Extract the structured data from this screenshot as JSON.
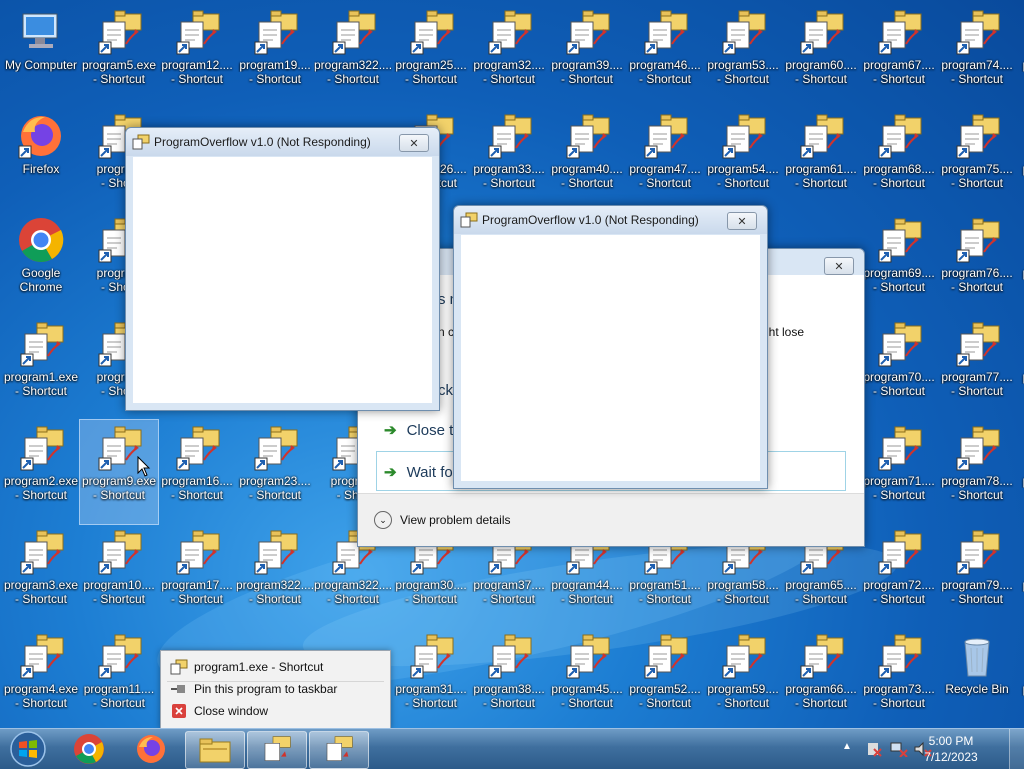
{
  "desktop": {
    "icons": [
      {
        "label1": "My Computer",
        "label2": "",
        "type": "computer",
        "col": 0,
        "row": 0
      },
      {
        "label1": "Firefox",
        "label2": "",
        "type": "firefox",
        "col": 0,
        "row": 1
      },
      {
        "label1": "Google",
        "label2": "Chrome",
        "type": "chrome",
        "col": 0,
        "row": 2
      },
      {
        "label1": "program1.exe",
        "label2": "- Shortcut",
        "type": "shortcut",
        "col": 0,
        "row": 3
      },
      {
        "label1": "program2.exe",
        "label2": "- Shortcut",
        "type": "shortcut",
        "col": 0,
        "row": 4
      },
      {
        "label1": "program3.exe",
        "label2": "- Shortcut",
        "type": "shortcut",
        "col": 0,
        "row": 5
      },
      {
        "label1": "program4.exe",
        "label2": "- Shortcut",
        "type": "shortcut",
        "col": 0,
        "row": 6
      },
      {
        "label1": "program5.exe",
        "label2": "- Shortcut",
        "type": "shortcut",
        "col": 1,
        "row": 0
      },
      {
        "label1": "program",
        "label2": "- Short",
        "type": "shortcut",
        "col": 1,
        "row": 1
      },
      {
        "label1": "program",
        "label2": "- Short",
        "type": "shortcut",
        "col": 1,
        "row": 2
      },
      {
        "label1": "program",
        "label2": "- Short",
        "type": "shortcut",
        "col": 1,
        "row": 3
      },
      {
        "label1": "program9.exe",
        "label2": "- Shortcut",
        "type": "shortcut",
        "col": 1,
        "row": 4,
        "selected": true
      },
      {
        "label1": "program10....",
        "label2": "- Shortcut",
        "type": "shortcut",
        "col": 1,
        "row": 5
      },
      {
        "label1": "program11....",
        "label2": "- Shortcut",
        "type": "shortcut",
        "col": 1,
        "row": 6
      },
      {
        "label1": "program12....",
        "label2": "- Shortcut",
        "type": "shortcut",
        "col": 2,
        "row": 0
      },
      {
        "label1": "program16....",
        "label2": "- Shortcut",
        "type": "shortcut",
        "col": 2,
        "row": 4
      },
      {
        "label1": "program17....",
        "label2": "- Shortcut",
        "type": "shortcut",
        "col": 2,
        "row": 5
      },
      {
        "label1": "program19....",
        "label2": "- Shortcut",
        "type": "shortcut",
        "col": 3,
        "row": 0
      },
      {
        "label1": "program23....",
        "label2": "- Shortcut",
        "type": "shortcut",
        "col": 3,
        "row": 4
      },
      {
        "label1": "program322....",
        "label2": "- Shortcut",
        "type": "shortcut",
        "col": 3,
        "row": 5
      },
      {
        "label1": "program322....",
        "label2": "- Shortcut",
        "type": "shortcut",
        "col": 4,
        "row": 0
      },
      {
        "label1": "program",
        "label2": "- Shor",
        "type": "shortcut",
        "col": 4,
        "row": 4
      },
      {
        "label1": "program322....",
        "label2": "- Shortcut",
        "type": "shortcut",
        "col": 4,
        "row": 5
      },
      {
        "label1": "program25....",
        "label2": "- Shortcut",
        "type": "shortcut",
        "col": 5,
        "row": 0
      },
      {
        "label1": "program26....",
        "label2": "- Shortcut",
        "type": "shortcut",
        "col": 5,
        "row": 1
      },
      {
        "label1": "program30....",
        "label2": "- Shortcut",
        "type": "shortcut",
        "col": 5,
        "row": 5
      },
      {
        "label1": "program31....",
        "label2": "- Shortcut",
        "type": "shortcut",
        "col": 5,
        "row": 6
      },
      {
        "label1": "program32....",
        "label2": "- Shortcut",
        "type": "shortcut",
        "col": 6,
        "row": 0
      },
      {
        "label1": "program33....",
        "label2": "- Shortcut",
        "type": "shortcut",
        "col": 6,
        "row": 1
      },
      {
        "label1": "program37....",
        "label2": "- Shortcut",
        "type": "shortcut",
        "col": 6,
        "row": 5
      },
      {
        "label1": "program38....",
        "label2": "- Shortcut",
        "type": "shortcut",
        "col": 6,
        "row": 6
      },
      {
        "label1": "program39....",
        "label2": "- Shortcut",
        "type": "shortcut",
        "col": 7,
        "row": 0
      },
      {
        "label1": "program40....",
        "label2": "- Shortcut",
        "type": "shortcut",
        "col": 7,
        "row": 1
      },
      {
        "label1": "program44....",
        "label2": "- Shortcut",
        "type": "shortcut",
        "col": 7,
        "row": 5
      },
      {
        "label1": "program45....",
        "label2": "- Shortcut",
        "type": "shortcut",
        "col": 7,
        "row": 6
      },
      {
        "label1": "program46....",
        "label2": "- Shortcut",
        "type": "shortcut",
        "col": 8,
        "row": 0
      },
      {
        "label1": "program47....",
        "label2": "- Shortcut",
        "type": "shortcut",
        "col": 8,
        "row": 1
      },
      {
        "label1": "program51....",
        "label2": "- Shortcut",
        "type": "shortcut",
        "col": 8,
        "row": 5
      },
      {
        "label1": "program52....",
        "label2": "- Shortcut",
        "type": "shortcut",
        "col": 8,
        "row": 6
      },
      {
        "label1": "program53....",
        "label2": "- Shortcut",
        "type": "shortcut",
        "col": 9,
        "row": 0
      },
      {
        "label1": "program54....",
        "label2": "- Shortcut",
        "type": "shortcut",
        "col": 9,
        "row": 1
      },
      {
        "label1": "program58....",
        "label2": "- Shortcut",
        "type": "shortcut",
        "col": 9,
        "row": 5
      },
      {
        "label1": "program59....",
        "label2": "- Shortcut",
        "type": "shortcut",
        "col": 9,
        "row": 6
      },
      {
        "label1": "program60....",
        "label2": "- Shortcut",
        "type": "shortcut",
        "col": 10,
        "row": 0
      },
      {
        "label1": "program61....",
        "label2": "- Shortcut",
        "type": "shortcut",
        "col": 10,
        "row": 1
      },
      {
        "label1": "program65....",
        "label2": "- Shortcut",
        "type": "shortcut",
        "col": 10,
        "row": 5
      },
      {
        "label1": "program66....",
        "label2": "- Shortcut",
        "type": "shortcut",
        "col": 10,
        "row": 6
      },
      {
        "label1": "program67....",
        "label2": "- Shortcut",
        "type": "shortcut",
        "col": 11,
        "row": 0
      },
      {
        "label1": "program68....",
        "label2": "- Shortcut",
        "type": "shortcut",
        "col": 11,
        "row": 1
      },
      {
        "label1": "program69....",
        "label2": "- Shortcut",
        "type": "shortcut",
        "col": 11,
        "row": 2
      },
      {
        "label1": "program70....",
        "label2": "- Shortcut",
        "type": "shortcut",
        "col": 11,
        "row": 3
      },
      {
        "label1": "program71....",
        "label2": "- Shortcut",
        "type": "shortcut",
        "col": 11,
        "row": 4
      },
      {
        "label1": "program72....",
        "label2": "- Shortcut",
        "type": "shortcut",
        "col": 11,
        "row": 5
      },
      {
        "label1": "program73....",
        "label2": "- Shortcut",
        "type": "shortcut",
        "col": 11,
        "row": 6
      },
      {
        "label1": "program74....",
        "label2": "- Shortcut",
        "type": "shortcut",
        "col": 12,
        "row": 0
      },
      {
        "label1": "program75....",
        "label2": "- Shortcut",
        "type": "shortcut",
        "col": 12,
        "row": 1
      },
      {
        "label1": "program76....",
        "label2": "- Shortcut",
        "type": "shortcut",
        "col": 12,
        "row": 2
      },
      {
        "label1": "program77....",
        "label2": "- Shortcut",
        "type": "shortcut",
        "col": 12,
        "row": 3
      },
      {
        "label1": "program78....",
        "label2": "- Shortcut",
        "type": "shortcut",
        "col": 12,
        "row": 4
      },
      {
        "label1": "program79....",
        "label2": "- Shortcut",
        "type": "shortcut",
        "col": 12,
        "row": 5
      },
      {
        "label1": "Recycle Bin",
        "label2": "",
        "type": "recycle",
        "col": 12,
        "row": 6
      },
      {
        "label1": "p",
        "label2": "",
        "type": "partial",
        "col": 13,
        "row": 0
      },
      {
        "label1": "p",
        "label2": "",
        "type": "partial",
        "col": 13,
        "row": 1
      },
      {
        "label1": "p",
        "label2": "",
        "type": "partial",
        "col": 13,
        "row": 2
      },
      {
        "label1": "p",
        "label2": "",
        "type": "partial",
        "col": 13,
        "row": 3
      },
      {
        "label1": "p",
        "label2": "",
        "type": "partial",
        "col": 13,
        "row": 4
      },
      {
        "label1": "p",
        "label2": "",
        "type": "partial",
        "col": 13,
        "row": 5
      },
      {
        "label1": "p",
        "label2": "",
        "type": "partial",
        "col": 13,
        "row": 6
      }
    ]
  },
  "window1": {
    "title": "ProgramOverflow v1.0 (Not Responding)",
    "close": "✕"
  },
  "window2": {
    "title": "ProgramOverflow v1.0 (Not Responding)",
    "close": "✕"
  },
  "dialog": {
    "close": "✕",
    "frag_header": "s n",
    "frag_body": "n c",
    "frag_right": "ght lose",
    "frag_check": "ck",
    "opt_close": "Close t",
    "opt_wait": "Wait fo",
    "details": "View problem details"
  },
  "context_menu": {
    "items": [
      {
        "label": "program1.exe - Shortcut",
        "icon": "program-icon"
      },
      {
        "label": "Pin this program to taskbar",
        "icon": "pin-icon"
      },
      {
        "label": "Close window",
        "icon": "close-window-icon"
      }
    ]
  },
  "taskbar": {
    "time": "5:00 PM",
    "date": "7/12/2023",
    "buttons": [
      "start",
      "chrome",
      "firefox",
      "explorer",
      "program-window-1",
      "program-window-2"
    ]
  },
  "colors": {
    "accent": "#1d7ed3",
    "taskbar": "#3f6f9e",
    "shortcut_arrow": "#1e5fb0",
    "folder": "#f2d26a"
  }
}
